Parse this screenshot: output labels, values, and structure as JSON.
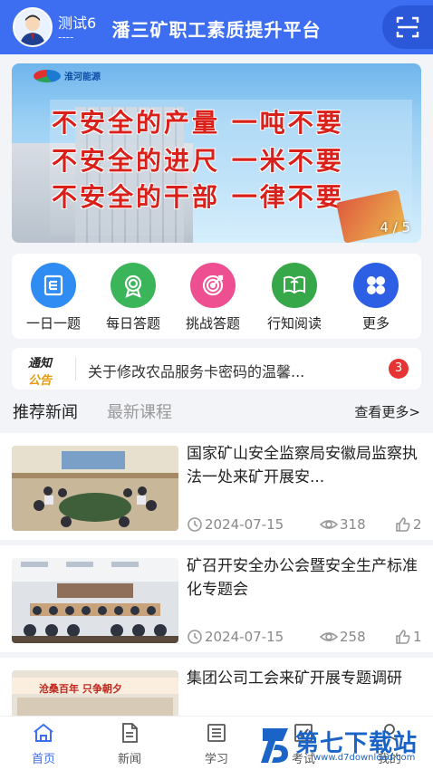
{
  "header": {
    "user_name": "测试6",
    "user_sub": "----",
    "title": "潘三矿职工素质提升平台"
  },
  "banner": {
    "logo_text": "淮河能源",
    "slogans": [
      "不安全的产量 一吨不要",
      "不安全的进尺 一米不要",
      "不安全的干部 一律不要"
    ],
    "counter": "4 / 5"
  },
  "quick_menu": [
    {
      "label": "一日一题",
      "icon": "calendar-icon",
      "color": "#2f8cf3"
    },
    {
      "label": "每日答题",
      "icon": "award-icon",
      "color": "#3bb55a"
    },
    {
      "label": "挑战答题",
      "icon": "target-icon",
      "color": "#ee4f91"
    },
    {
      "label": "行知阅读",
      "icon": "book-icon",
      "color": "#36a84a"
    },
    {
      "label": "更多",
      "icon": "grid-icon",
      "color": "#2d5fe4"
    }
  ],
  "notice": {
    "tag_line1": "通知",
    "tag_line2": "公告",
    "text": "关于修改农品服务卡密码的温馨...",
    "count": "3"
  },
  "tabs": {
    "active": "推荐新闻",
    "inactive": "最新课程",
    "more": "查看更多>"
  },
  "news": [
    {
      "title": "国家矿山安全监察局安徽局监察执法一处来矿开展安...",
      "date": "2024-07-15",
      "views": "318",
      "likes": "2"
    },
    {
      "title": "矿召开安全办公会暨安全生产标准化专题会",
      "date": "2024-07-15",
      "views": "258",
      "likes": "1"
    },
    {
      "title": "集团公司工会来矿开展专题调研",
      "thumb_text": "沧桑百年 只争朝夕",
      "date": "",
      "views": "",
      "likes": ""
    }
  ],
  "bottom_nav": [
    {
      "label": "首页",
      "icon": "home-icon",
      "active": true
    },
    {
      "label": "新闻",
      "icon": "news-icon",
      "active": false
    },
    {
      "label": "学习",
      "icon": "study-icon",
      "active": false
    },
    {
      "label": "考试",
      "icon": "exam-icon",
      "active": false
    },
    {
      "label": "我的",
      "icon": "profile-icon",
      "active": false
    }
  ],
  "watermark": {
    "main": "第七下载站",
    "sub": "www.d7download.com"
  },
  "colors": {
    "primary": "#3d6df0",
    "notice_badge": "#e63434",
    "slogan": "#d9201a"
  }
}
